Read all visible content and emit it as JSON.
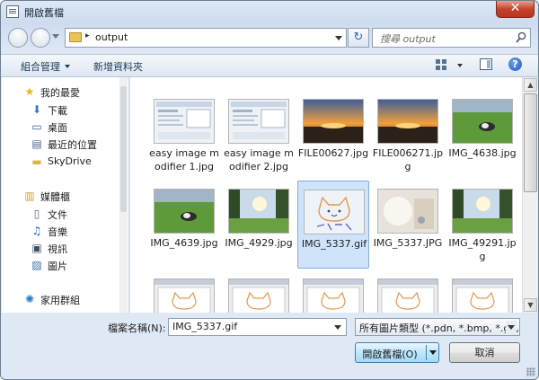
{
  "window": {
    "title": "開啟舊檔",
    "close_glyph": "✕"
  },
  "address_bar": {
    "crumb_separator": "▸",
    "path": "output",
    "refresh_glyph": "↻"
  },
  "search": {
    "placeholder": "搜尋 output"
  },
  "toolbar": {
    "organize_label": "組合管理",
    "new_folder_label": "新增資料夾",
    "help_glyph": "?"
  },
  "sidebar": {
    "items": [
      {
        "label": "我的最愛",
        "icon": "star-icon",
        "glyph": "★",
        "color": "#e8b51c",
        "indent": 0
      },
      {
        "label": "下載",
        "icon": "downloads-icon",
        "glyph": "⬇",
        "color": "#3b78c2",
        "indent": 1
      },
      {
        "label": "桌面",
        "icon": "desktop-icon",
        "glyph": "▭",
        "color": "#2e5e9c",
        "indent": 1
      },
      {
        "label": "最近的位置",
        "icon": "recent-places-icon",
        "glyph": "▤",
        "color": "#4d6b8d",
        "indent": 1
      },
      {
        "label": "SkyDrive",
        "icon": "folder-icon",
        "glyph": "▬",
        "color": "#e2b343",
        "indent": 1
      },
      {
        "label": "媒體櫃",
        "icon": "library-icon",
        "glyph": "▥",
        "color": "#d69f2c",
        "indent": 0
      },
      {
        "label": "文件",
        "icon": "documents-icon",
        "glyph": "▯",
        "color": "#4f6b8e",
        "indent": 1
      },
      {
        "label": "音樂",
        "icon": "music-icon",
        "glyph": "♫",
        "color": "#2a62ad",
        "indent": 1
      },
      {
        "label": "視訊",
        "icon": "video-icon",
        "glyph": "▣",
        "color": "#3d4f66",
        "indent": 1
      },
      {
        "label": "圖片",
        "icon": "pictures-icon",
        "glyph": "▨",
        "color": "#3e6fa8",
        "indent": 1
      },
      {
        "label": "家用群組",
        "icon": "homegroup-icon",
        "glyph": "✺",
        "color": "#2a7ec2",
        "indent": 0
      }
    ]
  },
  "files": [
    {
      "name": "easy image modifier 1.jpg",
      "thumb": "screenshot",
      "selected": false
    },
    {
      "name": "easy image modifier 2.jpg",
      "thumb": "screenshot",
      "selected": false
    },
    {
      "name": "FILE00627.jpg",
      "thumb": "sunset",
      "selected": false
    },
    {
      "name": "FILE006271.jpg",
      "thumb": "sunset",
      "selected": false
    },
    {
      "name": "IMG_4638.jpg",
      "thumb": "grass-dog",
      "selected": false
    },
    {
      "name": "IMG_4639.jpg",
      "thumb": "grass-dog",
      "selected": false
    },
    {
      "name": "IMG_4929.jpg",
      "thumb": "trees-sky",
      "selected": false
    },
    {
      "name": "IMG_5337.gif",
      "thumb": "cat-drawing",
      "selected": true
    },
    {
      "name": "IMG_5337.JPG",
      "thumb": "photo-light",
      "selected": false
    },
    {
      "name": "IMG_49291.jpg",
      "thumb": "trees-sky",
      "selected": false
    },
    {
      "name": "",
      "thumb": "cat-strip",
      "selected": false
    },
    {
      "name": "",
      "thumb": "cat-strip",
      "selected": false
    },
    {
      "name": "",
      "thumb": "cat-strip",
      "selected": false
    },
    {
      "name": "",
      "thumb": "cat-strip",
      "selected": false
    },
    {
      "name": "",
      "thumb": "cat-strip",
      "selected": false
    }
  ],
  "scrollbar": {
    "up_glyph": "▲",
    "down_glyph": "▼"
  },
  "footer": {
    "filename_label": "檔案名稱(N):",
    "filename_value": "IMG_5337.gif",
    "filetype_value": "所有圖片類型 (*.pdn, *.bmp, *.gif, *.ico, *.jpg)",
    "open_label": "開啟舊檔(O)",
    "cancel_label": "取消"
  },
  "colors": {
    "selection_bg": "#cfe3fa",
    "selection_border": "#84acdd",
    "accent": "#3c7fb1"
  }
}
